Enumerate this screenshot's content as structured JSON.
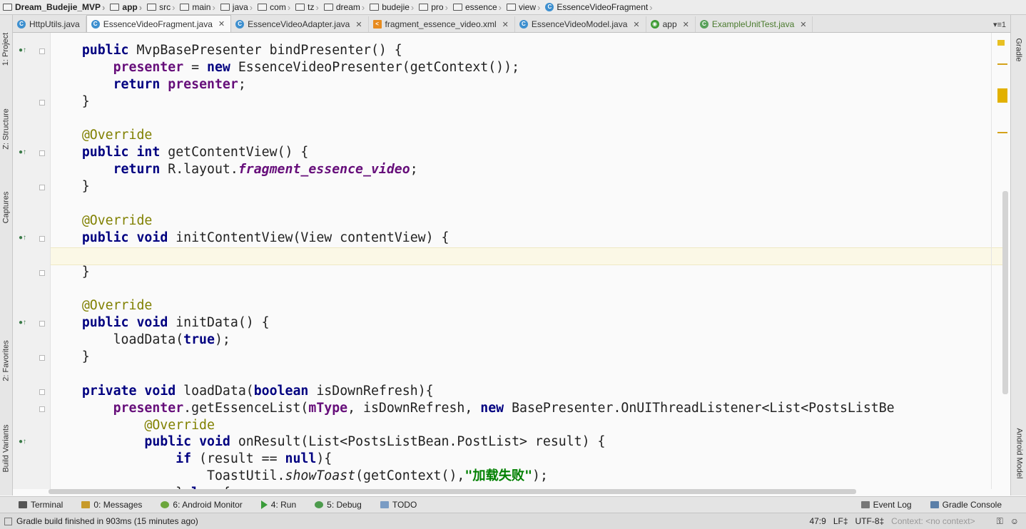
{
  "breadcrumbs": [
    "Dream_Budejie_MVP",
    "app",
    "src",
    "main",
    "java",
    "com",
    "tz",
    "dream",
    "budejie",
    "pro",
    "essence",
    "view",
    "EssenceVideoFragment"
  ],
  "tabs": [
    {
      "label": "HttpUtils.java",
      "icon": "class-icon",
      "close": false,
      "active": false
    },
    {
      "label": "EssenceVideoFragment.java",
      "icon": "class-icon",
      "close": true,
      "active": true
    },
    {
      "label": "EssenceVideoAdapter.java",
      "icon": "class-icon",
      "close": true,
      "active": false
    },
    {
      "label": "fragment_essence_video.xml",
      "icon": "xml-icon",
      "close": true,
      "active": false
    },
    {
      "label": "EssenceVideoModel.java",
      "icon": "class-icon",
      "close": true,
      "active": false
    },
    {
      "label": "app",
      "icon": "module-icon",
      "close": true,
      "active": false
    },
    {
      "label": "ExampleUnitTest.java",
      "icon": "test-class-icon",
      "close": true,
      "active": false
    }
  ],
  "tab_overflow": "▾≡1",
  "left_tools": [
    "1: Project",
    "Z: Structure",
    "Captures",
    "2: Favorites",
    "Build Variants"
  ],
  "right_tools": [
    "Gradle",
    "Android Model"
  ],
  "code_lines": [
    "    public MvpBasePresenter bindPresenter() {",
    "        presenter = new EssenceVideoPresenter(getContext());",
    "        return presenter;",
    "    }",
    "",
    "    @Override",
    "    public int getContentView() {",
    "        return R.layout.fragment_essence_video;",
    "    }",
    "",
    "    @Override",
    "    public void initContentView(View contentView) {",
    "",
    "    }",
    "",
    "    @Override",
    "    public void initData() {",
    "        loadData(true);",
    "    }",
    "",
    "    private void loadData(boolean isDownRefresh){",
    "        presenter.getEssenceList(mType, isDownRefresh, new BasePresenter.OnUIThreadListener<List<PostsListBe",
    "            @Override",
    "            public void onResult(List<PostsListBean.PostList> result) {",
    "                if (result == null){",
    "                    ToastUtil.showToast(getContext(),\"加载失败\");",
    "                }else {"
  ],
  "bottom_tools": [
    {
      "label": "Terminal",
      "icon": "terminal-icon"
    },
    {
      "label": "0: Messages",
      "icon": "messages-icon"
    },
    {
      "label": "6: Android Monitor",
      "icon": "android-icon"
    },
    {
      "label": "4: Run",
      "icon": "run-icon"
    },
    {
      "label": "5: Debug",
      "icon": "debug-icon"
    },
    {
      "label": "TODO",
      "icon": "todo-icon"
    }
  ],
  "bottom_right_tools": [
    {
      "label": "Event Log",
      "icon": "event-log-icon"
    },
    {
      "label": "Gradle Console",
      "icon": "gradle-console-icon"
    }
  ],
  "status": {
    "message": "Gradle build finished in 903ms (15 minutes ago)",
    "position": "47:9",
    "line_sep": "LF‡",
    "encoding": "UTF-8‡",
    "context": "Context: <no context>"
  },
  "colors": {
    "keyword": "#000080",
    "annotation": "#808000",
    "field": "#660e7a",
    "string": "#008000",
    "current_line": "#fbf8e6"
  }
}
